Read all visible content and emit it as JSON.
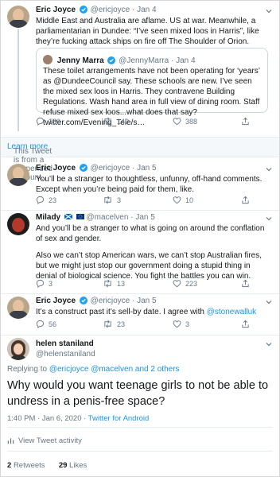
{
  "tweets": [
    {
      "name": "Eric Joyce",
      "handle": "@ericjoyce",
      "date": "Jan 4",
      "text": "Middle East and Australia are aflame. US at war. Meanwhile, a parliamentarian in Dundee: “I’ve seen mixed loos in Harris”, like they’re fucking attack ships on fire off The Shoulder of Orion.",
      "quote": {
        "name": "Jenny Marra",
        "handle": "@JennyMarra",
        "date": "Jan 4",
        "text": "These toilet arrangements have not been operating for ‘years’ as @DundeeCouncil say. These schools are new. I’ve seen the mixed sex loos in Harris. They contravene Building Regulations. Wash hand area in full view of dining room. Staff refuse mixed sex loos...what does that say? twitter.com/Evening_Tele/s…"
      },
      "replies": "180",
      "retweets": "149",
      "likes": "388"
    },
    {
      "name": "Eric Joyce",
      "handle": "@ericjoyce",
      "date": "Jan 5",
      "text": "You’ll be a stranger to thoughtless, unfunny, off-hand comments. Except when you’re being paid for them, like.",
      "replies": "23",
      "retweets": "3",
      "likes": "10"
    },
    {
      "name": "Milady",
      "handle": "@macelven",
      "date": "Jan 5",
      "text1": "And you’ll be a stranger to what is going on around the conflation of sex and gender.",
      "text2": "Also we can’t stop American wars, we can’t stop Australian fires, but we might just stop our government doing a stupid thing in denial of biological science. You fight the battles you can win.",
      "replies": "3",
      "retweets": "13",
      "likes": "223"
    },
    {
      "name": "Eric Joyce",
      "handle": "@ericjoyce",
      "date": "Jan 5",
      "text_before": "It’s a construct past it’s sell-by date. I agree with ",
      "mention": "@stonewalluk",
      "replies": "56",
      "retweets": "23",
      "likes": "3"
    }
  ],
  "suspended": {
    "text": "This Tweet is from a suspended account.",
    "link": "Learn more"
  },
  "main": {
    "name": "helen staniland",
    "handle": "@helenstaniland",
    "replying_prefix": "Replying to ",
    "replying_to": "@ericjoyce @macelven",
    "replying_suffix": " and 2 others",
    "text": "Why would you want teenage girls to not be able to undress in a penis-free space?",
    "time": "1:40 PM · Jan 6, 2020 · ",
    "source": "Twitter for Android",
    "activity": "View Tweet activity",
    "retweets_count": "2",
    "retweets_label": "Retweets",
    "likes_count": "29",
    "likes_label": "Likes"
  },
  "colors": {
    "accent": "#1b95e0",
    "muted": "#657786",
    "text": "#14171a",
    "verified": "#1da1f2"
  },
  "icons": [
    "reply-icon",
    "retweet-icon",
    "like-icon",
    "share-icon",
    "chevron-down-icon",
    "verified-icon",
    "analytics-icon"
  ]
}
